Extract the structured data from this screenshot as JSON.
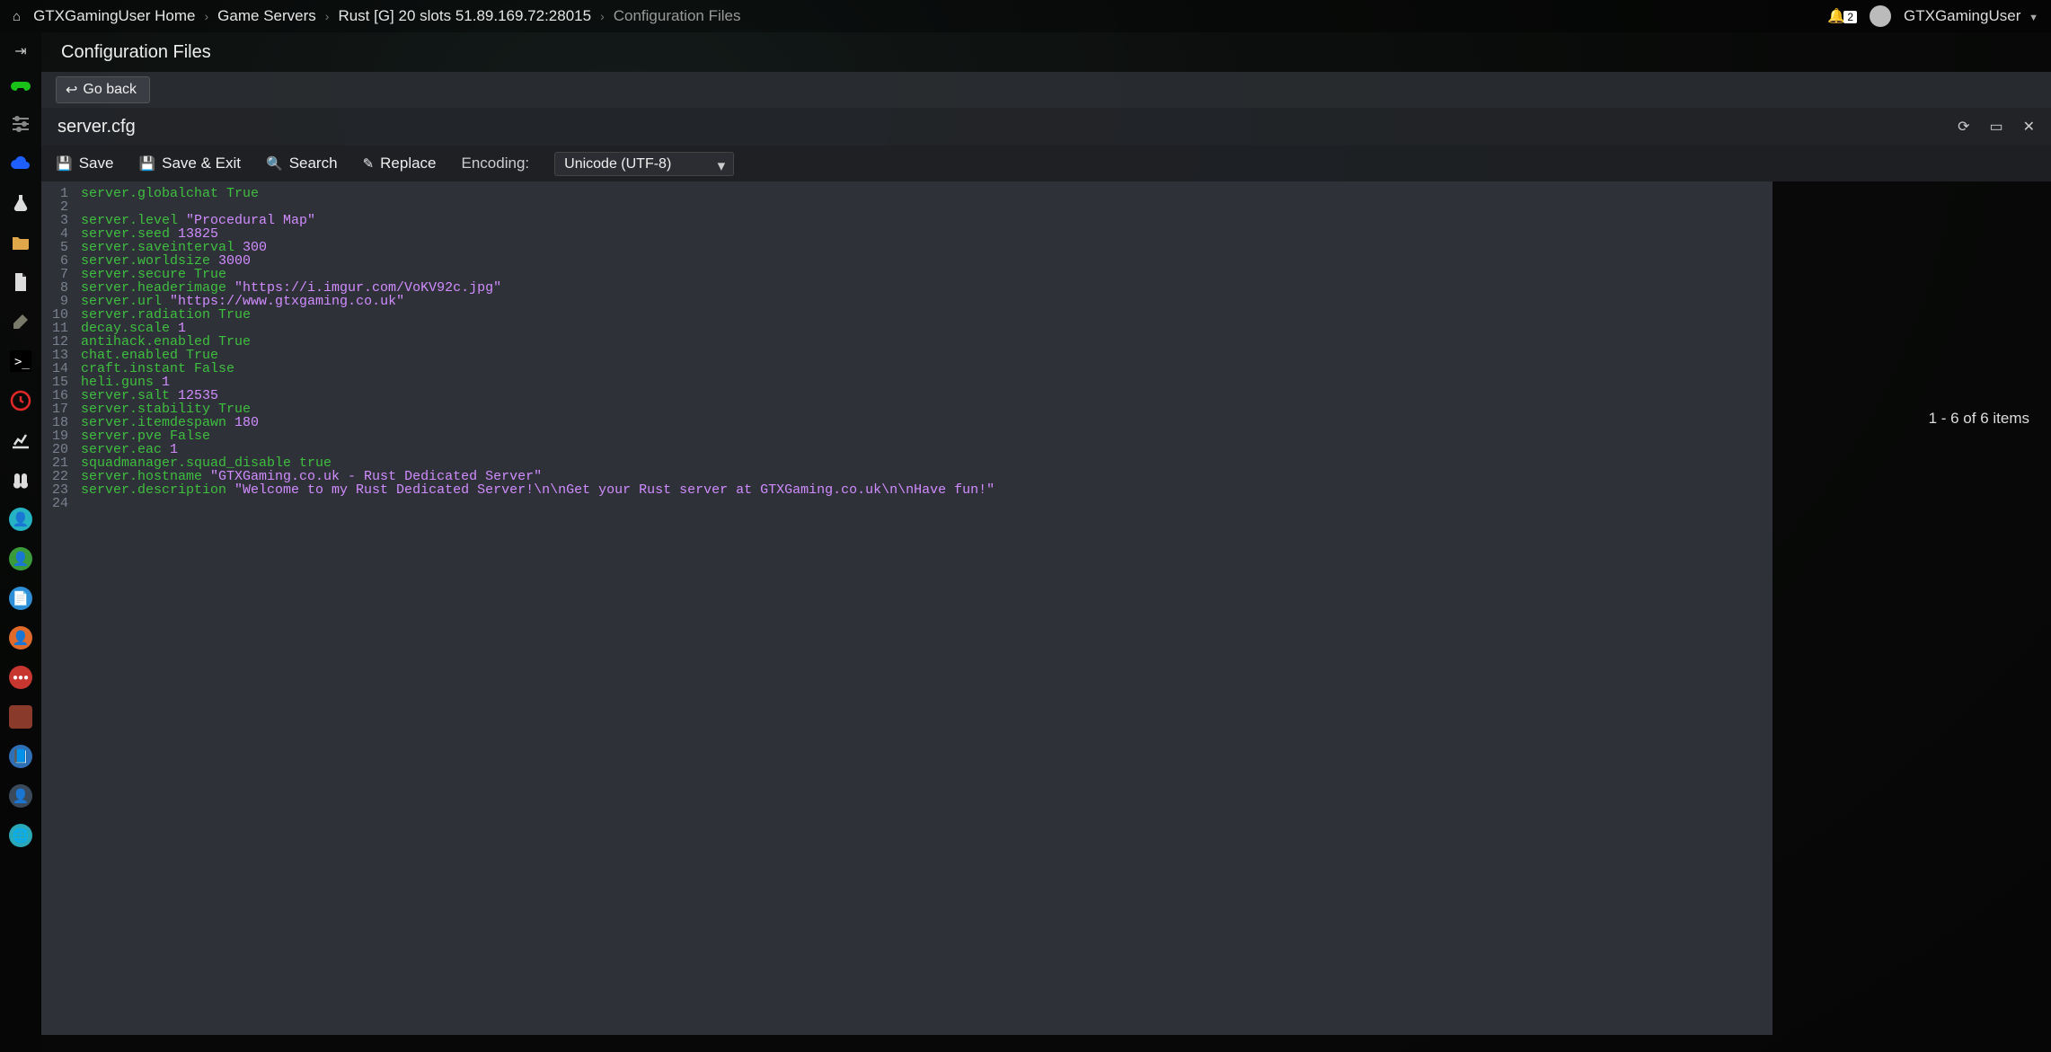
{
  "breadcrumb": {
    "home": "GTXGamingUser Home",
    "servers": "Game Servers",
    "instance": "Rust [G] 20 slots 51.89.169.72:28015",
    "page": "Configuration Files"
  },
  "user": {
    "name": "GTXGamingUser",
    "notif_count": "2"
  },
  "page_title": "Configuration Files",
  "goback": "Go back",
  "filename": "server.cfg",
  "toolbar": {
    "save": "Save",
    "save_exit": "Save & Exit",
    "search": "Search",
    "replace": "Replace",
    "encoding_label": "Encoding:",
    "encoding_value": "Unicode (UTF-8)"
  },
  "right_info": "1 - 6 of 6 items",
  "code_lines": [
    {
      "k": "server.globalchat",
      "v": "True",
      "t": "key"
    },
    {
      "blank": true
    },
    {
      "k": "server.level",
      "v": "\"Procedural Map\"",
      "t": "str"
    },
    {
      "k": "server.seed",
      "v": "13825",
      "t": "num"
    },
    {
      "k": "server.saveinterval",
      "v": "300",
      "t": "num"
    },
    {
      "k": "server.worldsize",
      "v": "3000",
      "t": "num"
    },
    {
      "k": "server.secure",
      "v": "True",
      "t": "key"
    },
    {
      "k": "server.headerimage",
      "v": "\"https://i.imgur.com/VoKV92c.jpg\"",
      "t": "str"
    },
    {
      "k": "server.url",
      "v": "\"https://www.gtxgaming.co.uk\"",
      "t": "str"
    },
    {
      "k": "server.radiation",
      "v": "True",
      "t": "key"
    },
    {
      "k": "decay.scale",
      "v": "1",
      "t": "num"
    },
    {
      "k": "antihack.enabled",
      "v": "True",
      "t": "key"
    },
    {
      "k": "chat.enabled",
      "v": "True",
      "t": "key"
    },
    {
      "k": "craft.instant",
      "v": "False",
      "t": "key"
    },
    {
      "k": "heli.guns",
      "v": "1",
      "t": "num"
    },
    {
      "k": "server.salt",
      "v": "12535",
      "t": "num"
    },
    {
      "k": "server.stability",
      "v": "True",
      "t": "key"
    },
    {
      "k": "server.itemdespawn",
      "v": "180",
      "t": "num"
    },
    {
      "k": "server.pve",
      "v": "False",
      "t": "key"
    },
    {
      "k": "server.eac",
      "v": "1",
      "t": "num"
    },
    {
      "k": "squadmanager.squad_disable",
      "v": "true",
      "t": "key"
    },
    {
      "k": "server.hostname",
      "v": "\"GTXGaming.co.uk - Rust Dedicated Server\"",
      "t": "str"
    },
    {
      "k": "server.description",
      "v": "\"Welcome to my Rust Dedicated Server!\\n\\nGet your Rust server at GTXGaming.co.uk\\n\\nHave fun!\"",
      "t": "str"
    },
    {
      "blank": true
    }
  ]
}
